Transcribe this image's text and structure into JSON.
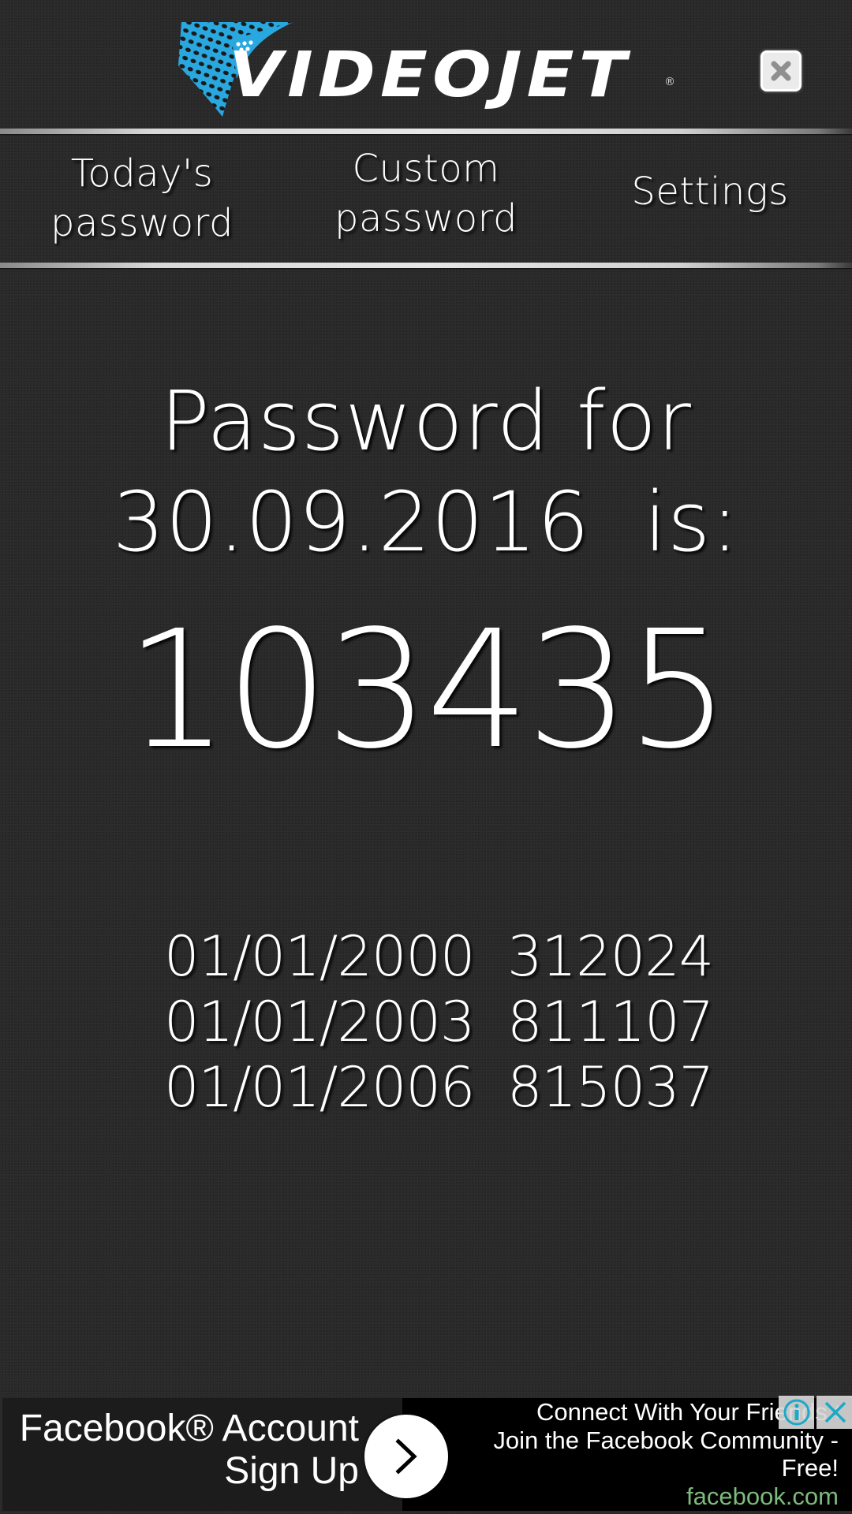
{
  "header": {
    "brand": "VIDEOJET",
    "registered_mark": "®",
    "logo_icon": "videojet-logo",
    "close_icon": "close-icon",
    "brand_color": "#29a8e0"
  },
  "tabs": [
    {
      "line1": "Today's",
      "line2": "password"
    },
    {
      "line1": "Custom",
      "line2": "password"
    },
    {
      "line1": "Settings",
      "line2": ""
    }
  ],
  "main": {
    "title_line1": "Password for",
    "title_line2": "30.09.2016  is:",
    "password": "103435",
    "history": [
      {
        "date": "01/01/2000",
        "code": "312024"
      },
      {
        "date": "01/01/2003",
        "code": "811107"
      },
      {
        "date": "01/01/2006",
        "code": "815037"
      }
    ]
  },
  "ad": {
    "headline_line1": "Facebook® Account",
    "headline_line2": "Sign Up",
    "arrow_icon": "chevron-right-icon",
    "desc_line1": "Connect With Your Friends Online",
    "desc_line2": "Join the Facebook Community -",
    "desc_line3": "Free!",
    "domain": "facebook.com",
    "domain_color": "#7dba7d",
    "info_icon": "info-icon",
    "close_icon": "close-icon",
    "icon_color": "#1aa9c8"
  }
}
